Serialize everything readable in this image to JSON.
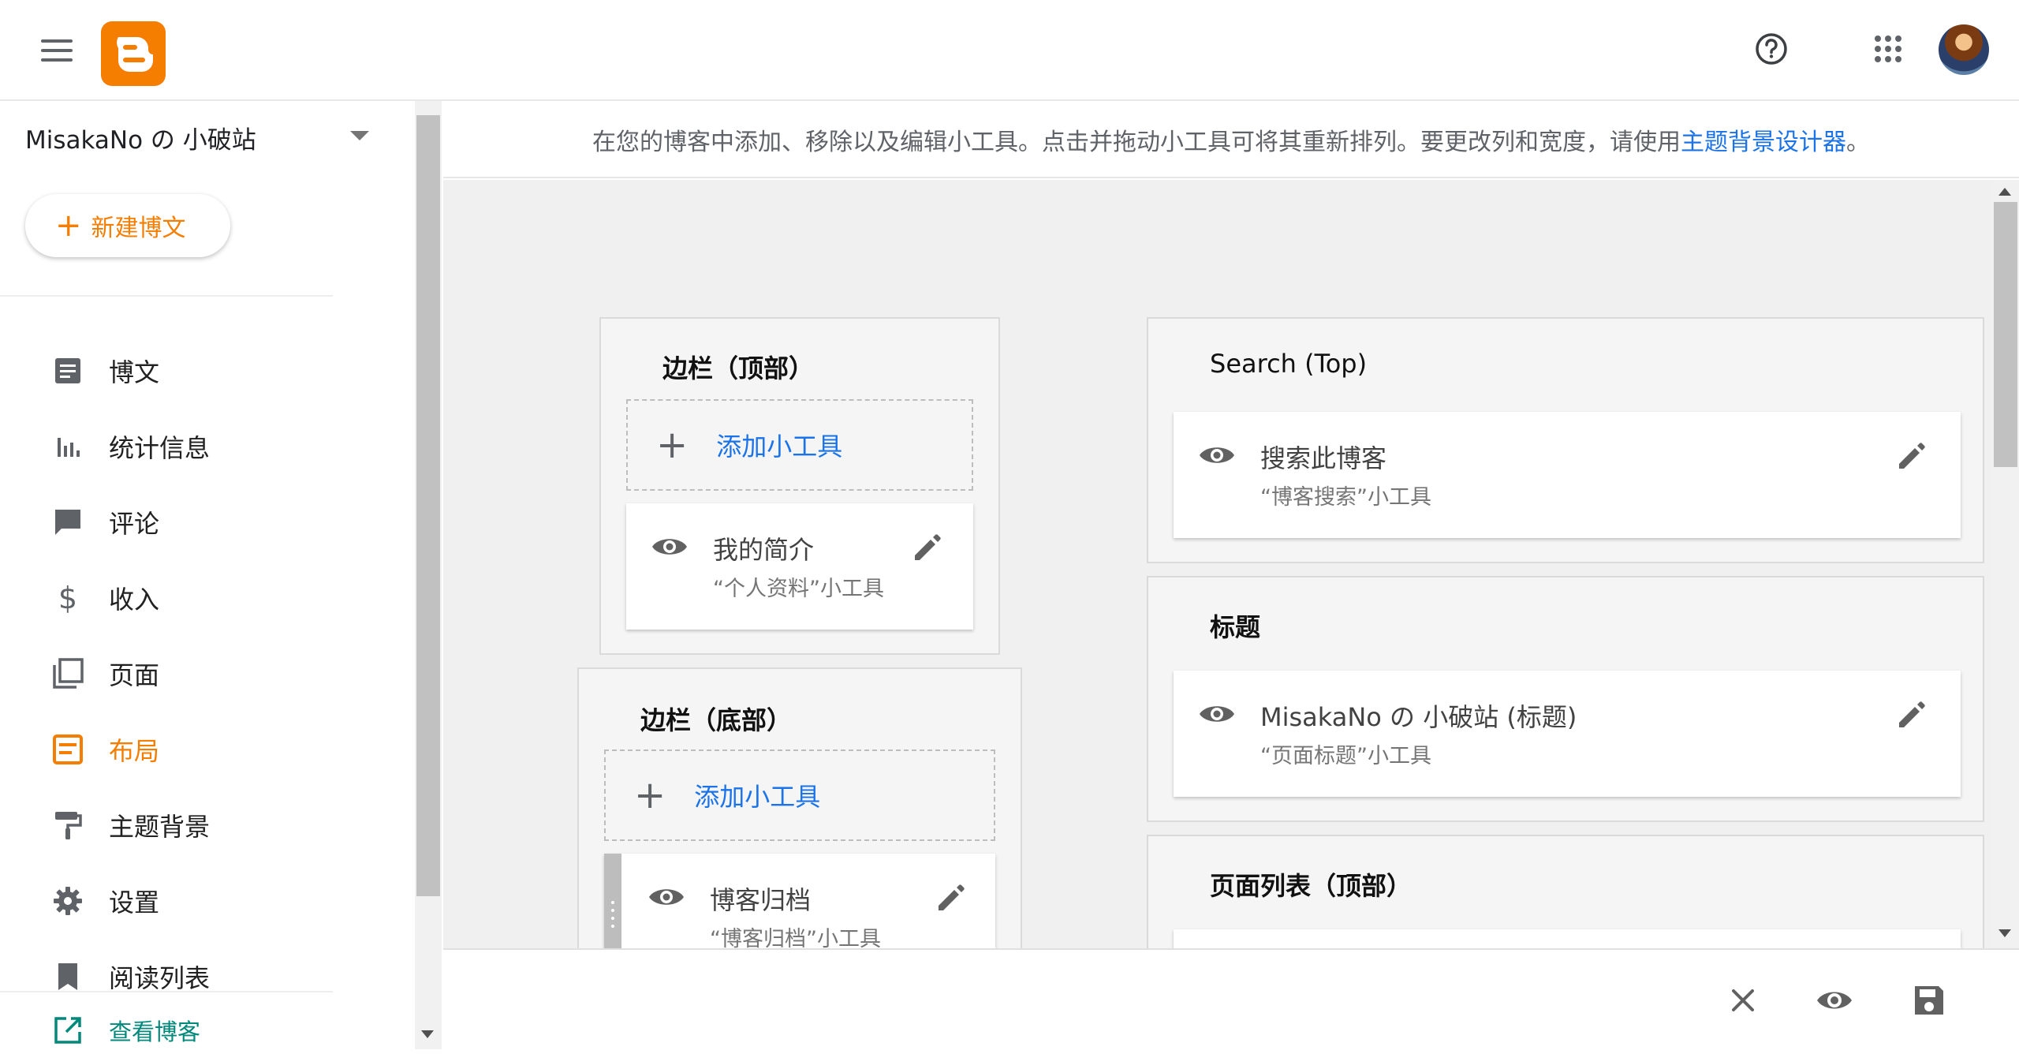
{
  "header": {
    "menu_icon": "hamburger-icon",
    "logo": "blogger-logo",
    "help_icon": "help-circle-icon",
    "apps_icon": "apps-grid-icon",
    "avatar": "user-avatar"
  },
  "sidebar": {
    "blog_name": "MisakaNo の 小破站",
    "new_post_label": "新建博文",
    "items": [
      {
        "label": "博文",
        "icon": "posts-icon"
      },
      {
        "label": "统计信息",
        "icon": "stats-icon"
      },
      {
        "label": "评论",
        "icon": "comments-icon"
      },
      {
        "label": "收入",
        "icon": "dollar-icon"
      },
      {
        "label": "页面",
        "icon": "pages-icon"
      },
      {
        "label": "布局",
        "icon": "layout-icon",
        "active": true
      },
      {
        "label": "主题背景",
        "icon": "paint-roller-icon"
      },
      {
        "label": "设置",
        "icon": "gear-icon"
      },
      {
        "label": "阅读列表",
        "icon": "bookmark-icon"
      }
    ],
    "view_blog_label": "查看博客"
  },
  "info": {
    "text": "在您的博客中添加、移除以及编辑小工具。点击并拖动小工具可将其重新排列。要更改列和宽度，请使用",
    "link": "主题背景设计器",
    "suffix": "。"
  },
  "layout": {
    "sidebar_top": {
      "title": "边栏（顶部）",
      "add_label": "添加小工具",
      "widgets": [
        {
          "name": "我的简介",
          "type": "“个人资料”小工具"
        }
      ]
    },
    "sidebar_bottom": {
      "title": "边栏（底部）",
      "add_label": "添加小工具",
      "widgets": [
        {
          "name": "博客归档",
          "type": "“博客归档”小工具"
        }
      ]
    },
    "search_top": {
      "title": "Search (Top)",
      "widgets": [
        {
          "name": "搜索此博客",
          "type": "“博客搜索”小工具"
        }
      ]
    },
    "header": {
      "title": "标题",
      "widgets": [
        {
          "name": "MisakaNo の 小破站 (标题)",
          "type": "“页面标题”小工具"
        }
      ]
    },
    "pagelist_top": {
      "title": "页面列表（顶部）"
    }
  },
  "bottombar": {
    "close_icon": "close-icon",
    "preview_icon": "eye-icon",
    "save_icon": "save-icon"
  },
  "colors": {
    "accent": "#f57d00",
    "link": "#1a73e8",
    "view_blog": "#00897b"
  }
}
